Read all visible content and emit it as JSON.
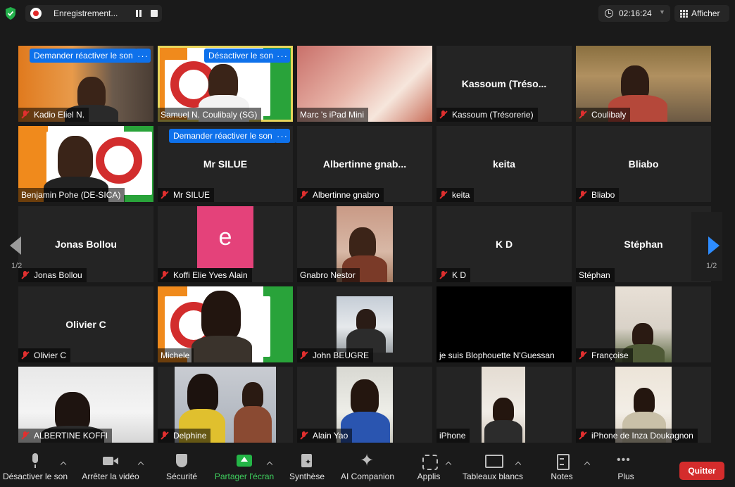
{
  "topbar": {
    "recording_label": "Enregistrement...",
    "timer": "02:16:24",
    "view_label": "Afficher"
  },
  "gallery": {
    "page_indicator": "1/2",
    "tiles": [
      {
        "name": "Kadio Eliel N.",
        "muted": true,
        "video": "orange",
        "overlay_button": "Demander réactiver le son"
      },
      {
        "name": "Samuel N. Coulibaly (SG)",
        "muted": false,
        "video": "flag",
        "overlay_button": "Désactiver le son",
        "speaking": true
      },
      {
        "name": "Marc 's iPad Mini",
        "muted": false,
        "video": "pink"
      },
      {
        "name": "Kassoum (Trésorerie)",
        "center_label": "Kassoum  (Tréso...",
        "muted": true
      },
      {
        "name": "Coulibaly",
        "muted": true,
        "video": "room"
      },
      {
        "name": "Benjamin Pohe (DE-SICA)",
        "muted": false,
        "video": "flag"
      },
      {
        "name": "Mr SILUE",
        "center_label": "Mr SILUE",
        "muted": true,
        "overlay_button": "Demander réactiver le son"
      },
      {
        "name": "Albertinne gnabro",
        "center_label": "Albertinne  gnab...",
        "muted": true
      },
      {
        "name": "keita",
        "center_label": "keita",
        "muted": true
      },
      {
        "name": "Bliabo",
        "center_label": "Bliabo",
        "muted": true
      },
      {
        "name": "Jonas Bollou",
        "center_label": "Jonas Bollou",
        "muted": true
      },
      {
        "name": "Koffi Elie Yves Alain",
        "avatar_letter": "e",
        "muted": true
      },
      {
        "name": "Gnabro Nestor",
        "muted": false,
        "video": "cam"
      },
      {
        "name": "K D",
        "center_label": "K D",
        "muted": true
      },
      {
        "name": "Stéphan",
        "center_label": "Stéphan",
        "muted": false
      },
      {
        "name": "Olivier C",
        "center_label": "Olivier C",
        "muted": true
      },
      {
        "name": "Michele",
        "muted": false,
        "video": "flag"
      },
      {
        "name": "John BEUGRE",
        "muted": true,
        "video": "cam"
      },
      {
        "name": "je suis Blophouette N'Guessan",
        "muted": false,
        "video": "black"
      },
      {
        "name": "Françoise",
        "muted": true,
        "video": "cam"
      },
      {
        "name": "ALBERTINE KOFFI",
        "muted": true,
        "video": "cam"
      },
      {
        "name": "Delphine",
        "muted": true,
        "video": "cam"
      },
      {
        "name": "Alain Yao",
        "muted": true,
        "video": "cam"
      },
      {
        "name": "iPhone",
        "muted": false,
        "video": "cam"
      },
      {
        "name": "iPhone de Inza Doukagnon",
        "muted": true,
        "video": "cam"
      }
    ]
  },
  "toolbar": {
    "mute": "Désactiver le son",
    "video": "Arrêter la vidéo",
    "security": "Sécurité",
    "share": "Partager l'écran",
    "summary": "Synthèse",
    "ai": "AI Companion",
    "apps": "Applis",
    "whiteboards": "Tableaux blancs",
    "notes": "Notes",
    "more": "Plus",
    "quit": "Quitter"
  },
  "colors": {
    "accent_blue": "#0e71eb",
    "speaking_border": "#e8d55b",
    "share_green": "#24b547",
    "quit_red": "#d42c2c",
    "muted_red": "#e02f2f"
  }
}
